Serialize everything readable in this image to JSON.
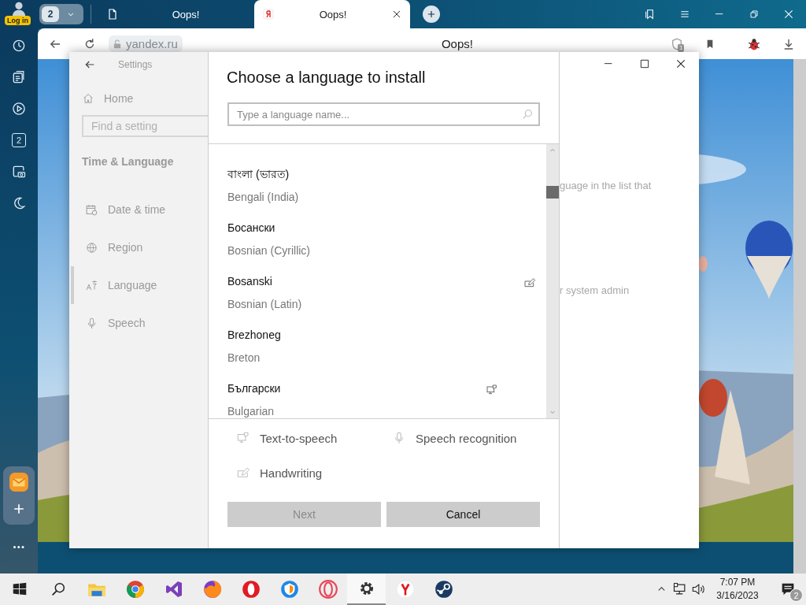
{
  "browser": {
    "profile_badge": "Log in",
    "tab_counter": "2",
    "tabs": [
      {
        "title": "Oops!",
        "selected": false
      },
      {
        "title": "Oops!",
        "selected": true
      }
    ],
    "address": "yandex.ru",
    "page_title": "Oops!",
    "shield_count": "1"
  },
  "sidebar": {
    "items": [
      {
        "kind": "history"
      },
      {
        "kind": "notes"
      },
      {
        "kind": "play"
      },
      {
        "kind": "counter",
        "label": "2"
      },
      {
        "kind": "screenshot"
      },
      {
        "kind": "moon"
      }
    ],
    "apps": [
      {
        "kind": "mail"
      },
      {
        "kind": "add"
      }
    ]
  },
  "settings": {
    "title": "Settings",
    "home": "Home",
    "search": {
      "placeholder": "Find a setting"
    },
    "section": "Time & Language",
    "pages": [
      {
        "label": "Date & time",
        "selected": false
      },
      {
        "label": "Region",
        "selected": false
      },
      {
        "label": "Language",
        "selected": true
      },
      {
        "label": "Speech",
        "selected": false
      }
    ],
    "body_fragments": [
      "guage in the list that",
      "r system admin"
    ]
  },
  "dialog": {
    "title": "Choose a language to install",
    "search": {
      "placeholder": "Type a language name..."
    },
    "languages": [
      {
        "native": "বাংলা (ভারত)",
        "english": "Bengali (India)",
        "tts": false,
        "handwriting": false
      },
      {
        "native": "Босански",
        "english": "Bosnian (Cyrillic)",
        "tts": false,
        "handwriting": false
      },
      {
        "native": "Bosanski",
        "english": "Bosnian (Latin)",
        "tts": false,
        "handwriting": true
      },
      {
        "native": "Brezhoneg",
        "english": "Breton",
        "tts": false,
        "handwriting": false
      },
      {
        "native": "Български",
        "english": "Bulgarian",
        "tts": true,
        "handwriting": false
      }
    ],
    "legend": [
      {
        "kind": "tts",
        "label": "Text-to-speech"
      },
      {
        "kind": "speech",
        "label": "Speech recognition"
      },
      {
        "kind": "handwriting",
        "label": "Handwriting"
      }
    ],
    "buttons": [
      {
        "label": "Next",
        "disabled": true
      },
      {
        "label": "Cancel",
        "disabled": false
      }
    ]
  },
  "taskbar": {
    "apps": [
      {
        "kind": "start",
        "selected": false
      },
      {
        "kind": "search",
        "selected": false
      },
      {
        "kind": "folder",
        "selected": false
      },
      {
        "kind": "chrome",
        "selected": false
      },
      {
        "kind": "ribbon",
        "selected": false
      },
      {
        "kind": "fox",
        "selected": false
      },
      {
        "kind": "ring",
        "selected": false
      },
      {
        "kind": "shield",
        "selected": false
      },
      {
        "kind": "thinring",
        "selected": false
      },
      {
        "kind": "gear",
        "selected": true
      },
      {
        "kind": "ylogo",
        "selected": false
      },
      {
        "kind": "steam",
        "selected": false
      }
    ],
    "time": "7:07 PM",
    "date": "3/16/2023",
    "notifications": "2"
  }
}
